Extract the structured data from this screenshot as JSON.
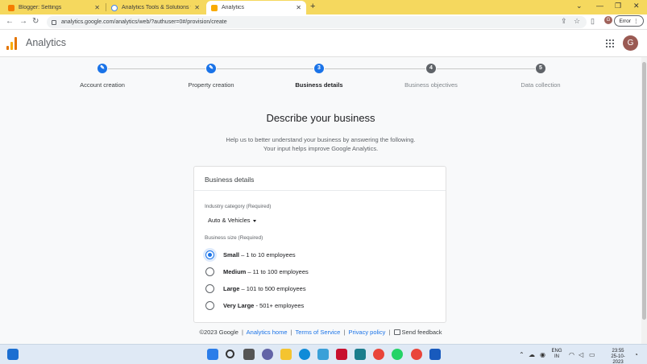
{
  "browser": {
    "tabs": [
      {
        "title": "Blogger: Settings",
        "favicon_color": "#f57c00",
        "active": false
      },
      {
        "title": "Analytics Tools & Solutions for Yo",
        "favicon_color": "#4285f4",
        "active": false
      },
      {
        "title": "Analytics",
        "favicon_color": "#f9ab00",
        "active": true
      }
    ],
    "new_tab_glyph": "+",
    "url": "analytics.google.com/analytics/web/?authuser=0#/provision/create",
    "profile_initial": "G",
    "error_label": "Error"
  },
  "header": {
    "app_title": "Analytics",
    "avatar_initial": "G"
  },
  "stepper": {
    "steps": [
      {
        "label": "Account creation",
        "state": "done",
        "marker": "✎"
      },
      {
        "label": "Property creation",
        "state": "done",
        "marker": "✎"
      },
      {
        "label": "Business details",
        "state": "current",
        "marker": "3"
      },
      {
        "label": "Business objectives",
        "state": "todo",
        "marker": "4"
      },
      {
        "label": "Data collection",
        "state": "todo",
        "marker": "5"
      }
    ]
  },
  "main": {
    "heading": "Describe your business",
    "subtitle_line1": "Help us to better understand your business by answering the following.",
    "subtitle_line2": "Your input helps improve Google Analytics."
  },
  "card": {
    "title": "Business details",
    "industry_label": "Industry category (Required)",
    "industry_value": "Auto & Vehicles",
    "size_label": "Business size (Required)",
    "size_options": [
      {
        "bold": "Small",
        "rest": " – 1 to 10 employees",
        "checked": true
      },
      {
        "bold": "Medium",
        "rest": " – 11 to 100 employees",
        "checked": false
      },
      {
        "bold": "Large",
        "rest": " – 101 to 500 employees",
        "checked": false
      },
      {
        "bold": "Very Large",
        "rest": " - 501+ employees",
        "checked": false
      }
    ]
  },
  "footer": {
    "copyright": "©2023 Google",
    "home_link": "Analytics home",
    "terms_link": "Terms of Service",
    "privacy_link": "Privacy policy",
    "feedback": "Send feedback"
  },
  "taskbar": {
    "lang_line1": "ENG",
    "lang_line2": "IN",
    "time": "23:55",
    "date": "25-10-2023"
  },
  "colors": {
    "tabstrip": "#f5d85e",
    "accent": "#1a73e8",
    "taskbar": "#dfe9f5"
  }
}
